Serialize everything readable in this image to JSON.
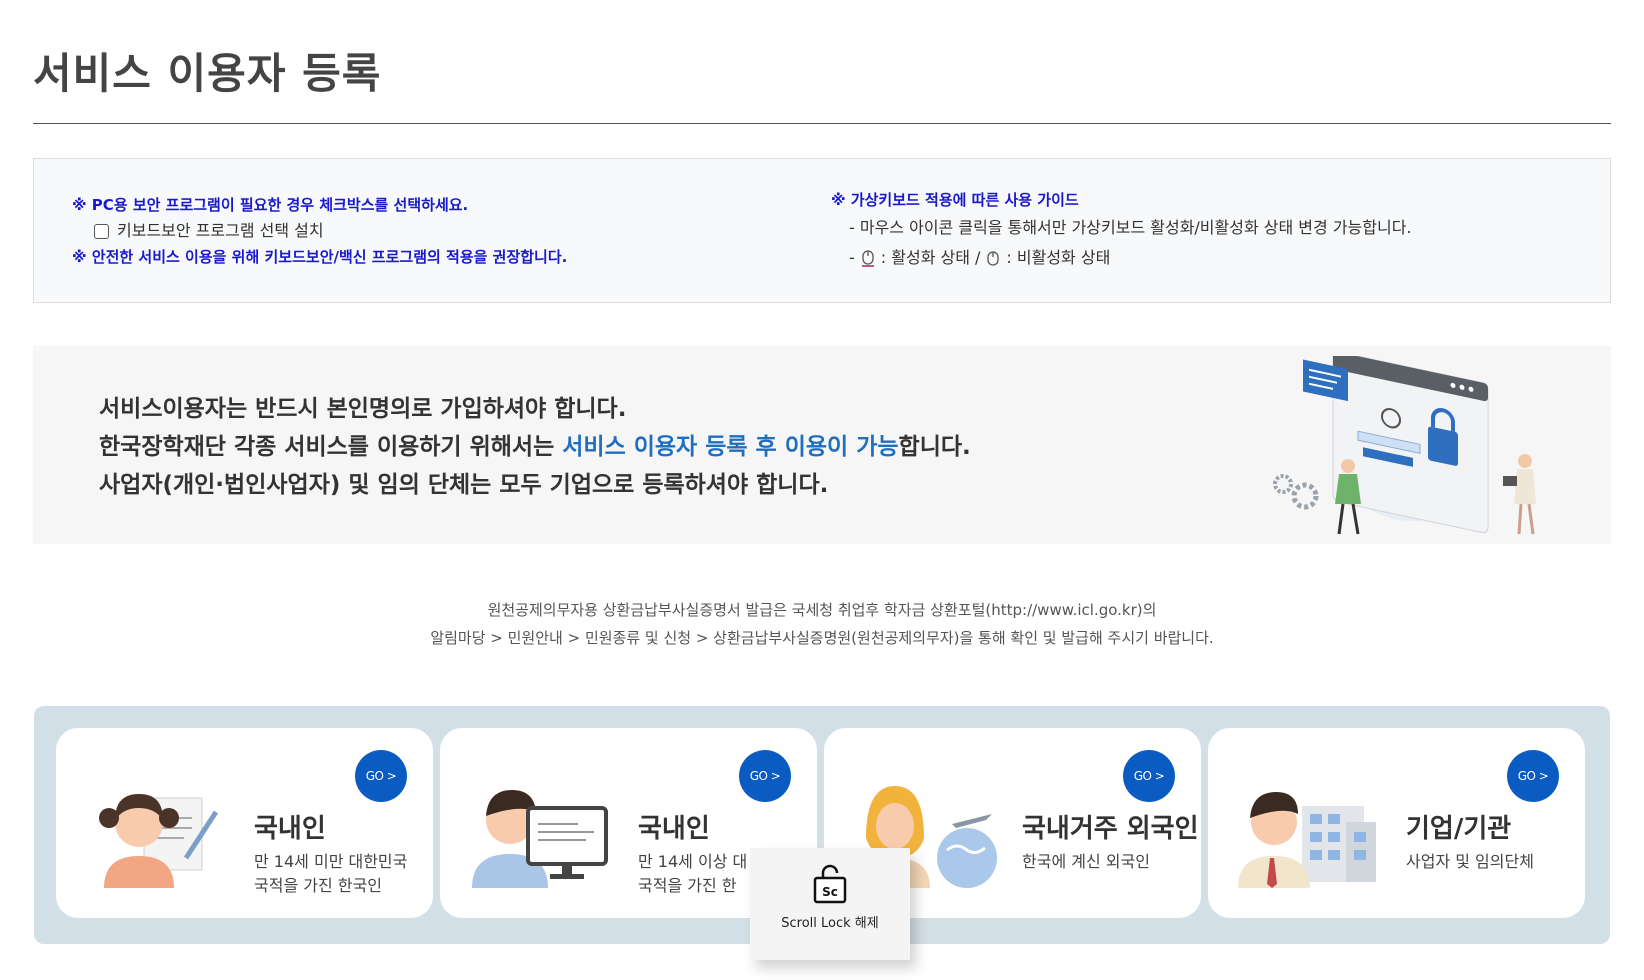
{
  "page": {
    "title": "서비스 이용자 등록"
  },
  "notice": {
    "left": {
      "security_note": "※ PC용 보안 프로그램이 필요한 경우 체크박스를 선택하세요.",
      "keyboard_checkbox_label": "키보드보안 프로그램 선택 설치",
      "recommend_note": "※ 안전한 서비스 이용을 위해 키보드보안/백신 프로그램의 적용을 권장합니다."
    },
    "right": {
      "guide_title": "※ 가상키보드 적용에 따른 사용 가이드",
      "guide_line1": "- 마우스 아이콘 클릭을 통해서만 가상키보드 활성화/비활성화 상태 변경 가능합니다.",
      "guide_dash": "-",
      "active_label": ": 활성화 상태 /",
      "inactive_label": ": 비활성화 상태"
    }
  },
  "banner": {
    "line1": "서비스이용자는 반드시 본인명의로 가입하셔야 합니다.",
    "line2_prefix": "한국장학재단 각종 서비스를 이용하기 위해서는 ",
    "line2_highlight": "서비스 이용자 등록 후 이용이 가능",
    "line2_suffix": "합니다.",
    "line3": "사업자(개인·법인사업자) 및 임의 단체는 모두 기업으로 등록하셔야 합니다."
  },
  "cert_note": {
    "line1": "원천공제의무자용 상환금납부사실증명서 발급은 국세청 취업후 학자금 상환포털(http://www.icl.go.kr)의",
    "line2": "알림마당 > 민원안내 > 민원종류 및 신청 > 상환금납부사실증명원(원천공제의무자)을 통해 확인 및 발급해 주시기 바랍니다."
  },
  "cards": [
    {
      "go_label": "GO >",
      "title": "국내인",
      "desc_line1": "만 14세 미만 대한민국",
      "desc_line2": "국적을 가진 한국인"
    },
    {
      "go_label": "GO >",
      "title": "국내인",
      "desc_line1": "만 14세 이상 대",
      "desc_line2": "국적을 가진 한"
    },
    {
      "go_label": "GO >",
      "title": "국내거주 외국인",
      "desc_line1": "한국에 계신 외국인",
      "desc_line2": ""
    },
    {
      "go_label": "GO >",
      "title": "기업/기관",
      "desc_line1": "사업자 및 임의단체",
      "desc_line2": ""
    }
  ],
  "scroll_popup": {
    "icon_text": "Sc",
    "label": "Scroll Lock 해제"
  },
  "colors": {
    "link_blue": "#1a1acc",
    "highlight_blue": "#1f6fbf",
    "go_button": "#0a5cc2",
    "panel_bg": "#d3dfe6"
  }
}
